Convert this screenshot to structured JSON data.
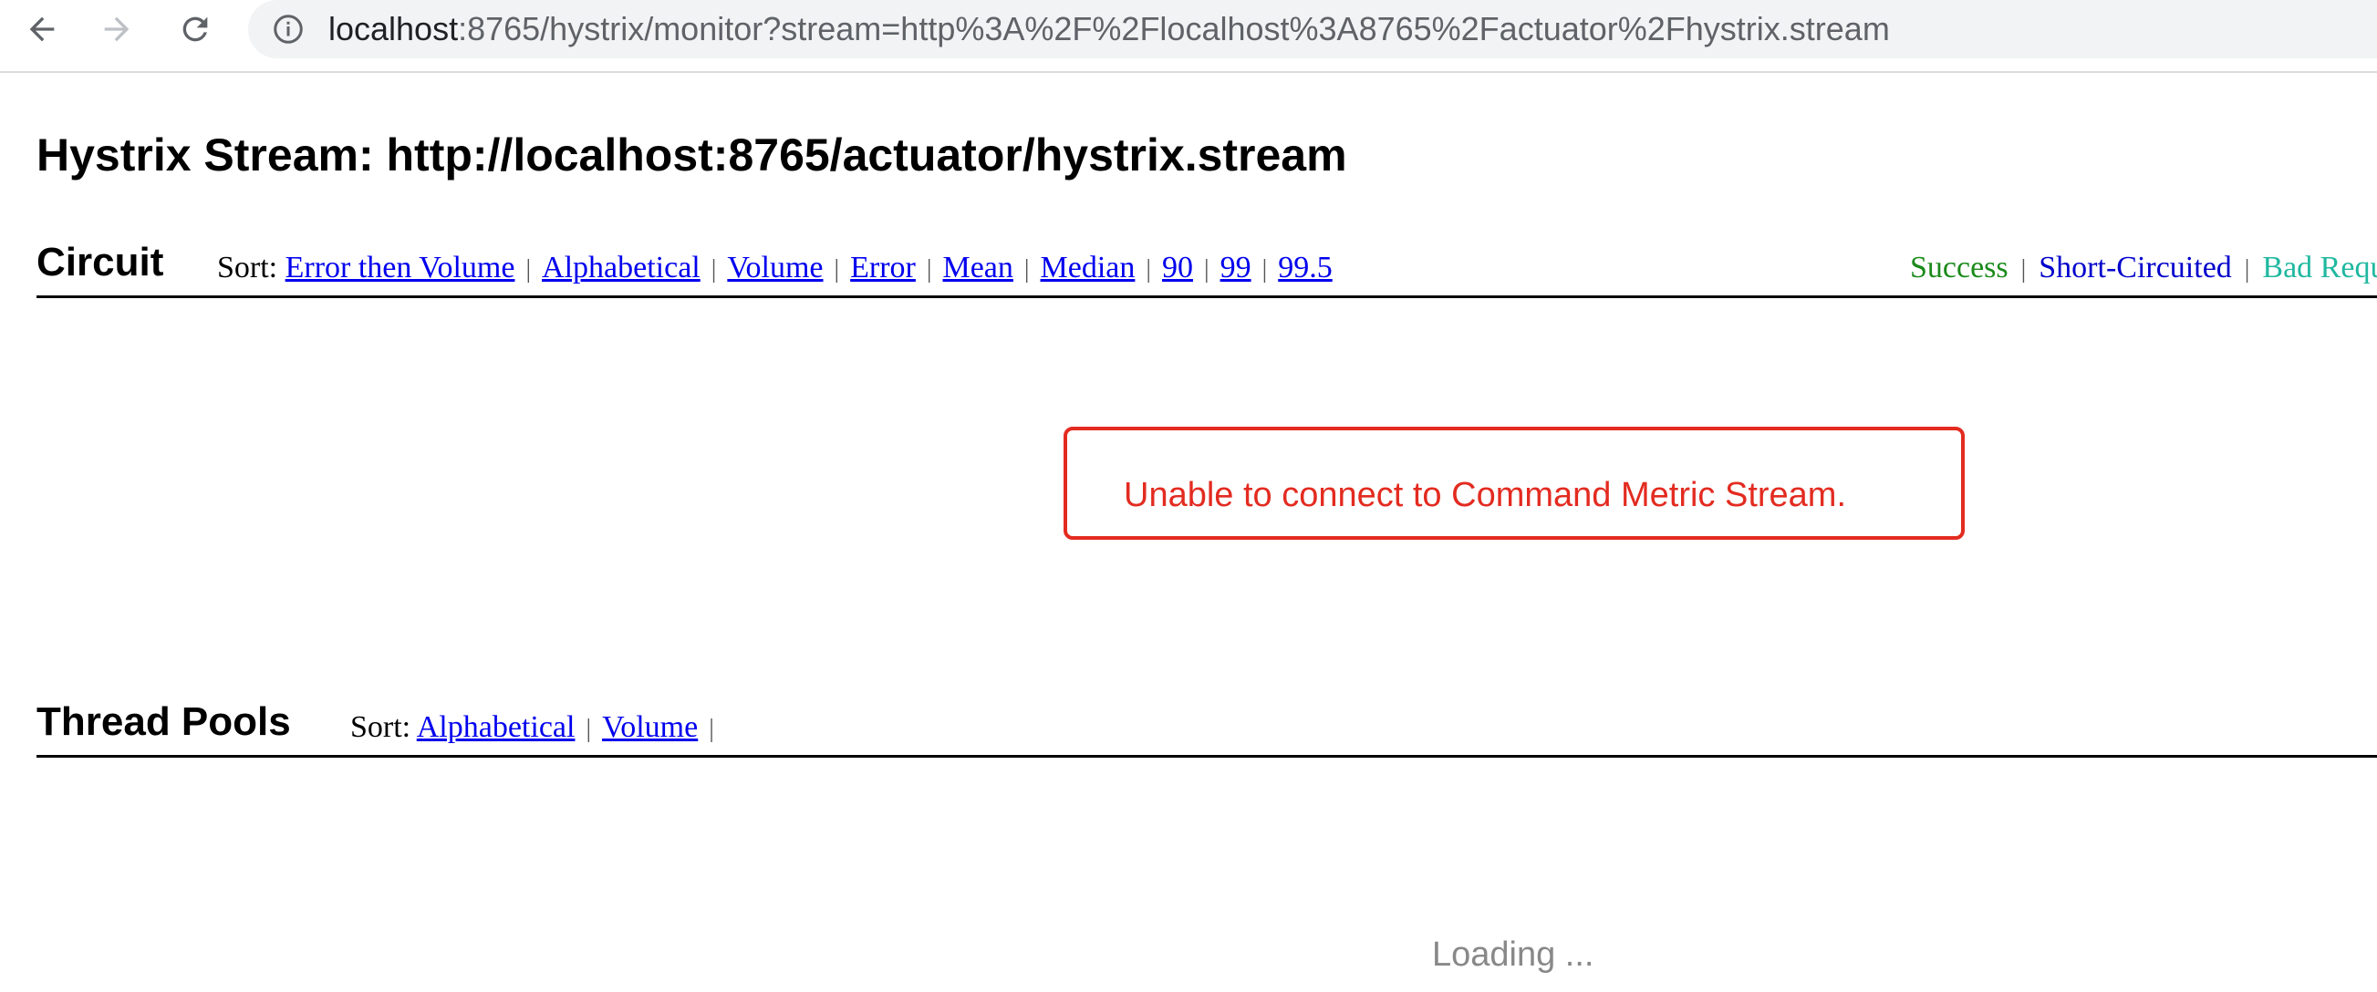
{
  "browser": {
    "url_host": "localhost",
    "url_path": ":8765/hystrix/monitor?stream=http%3A%2F%2Flocalhost%3A8765%2Factuator%2Fhystrix.stream"
  },
  "page": {
    "title": "Hystrix Stream: http://localhost:8765/actuator/hystrix.stream"
  },
  "circuit": {
    "title": "Circuit",
    "sort_label": "Sort:",
    "sort_options": [
      "Error then Volume",
      "Alphabetical",
      "Volume",
      "Error",
      "Mean",
      "Median",
      "90",
      "99",
      "99.5"
    ],
    "legend": [
      {
        "label": "Success",
        "color": "#1a8a1a"
      },
      {
        "label": "Short-Circuited",
        "color": "#0000cc"
      },
      {
        "label": "Bad Request",
        "color": "#20b8a0"
      }
    ],
    "error_message": "Unable to connect to Command Metric Stream."
  },
  "thread_pools": {
    "title": "Thread Pools",
    "sort_label": "Sort:",
    "sort_options": [
      "Alphabetical",
      "Volume"
    ],
    "loading_text": "Loading ..."
  },
  "colors": {
    "error": "#e32b20",
    "link": "#0000ee"
  }
}
